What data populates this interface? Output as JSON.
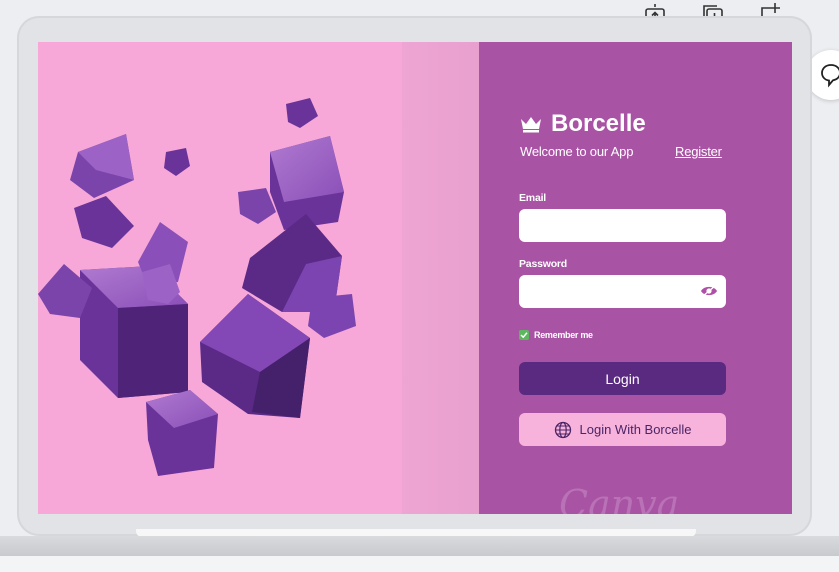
{
  "toolbar": {
    "icons": [
      "lock-share-icon",
      "duplicate-page-icon",
      "add-page-icon"
    ]
  },
  "side": {
    "comment_icon": "comment-icon"
  },
  "brand": {
    "name": "Borcelle",
    "icon": "crown-icon"
  },
  "welcome_text": "Welcome to our App",
  "register_link": "Register",
  "form": {
    "email_label": "Email",
    "email_value": "",
    "password_label": "Password",
    "password_value": "",
    "password_icon": "eye-icon",
    "remember_label": "Remember me",
    "remember_checked": true,
    "login_button": "Login",
    "alt_login_button": "Login With Borcelle",
    "alt_login_icon": "globe-icon"
  },
  "watermark": "Canva",
  "colors": {
    "panel": "#a953a5",
    "art_background": "#f7a8d8",
    "login_button": "#5a2a80",
    "alt_button": "#f7b3dc",
    "checkbox": "#5cb85c"
  }
}
